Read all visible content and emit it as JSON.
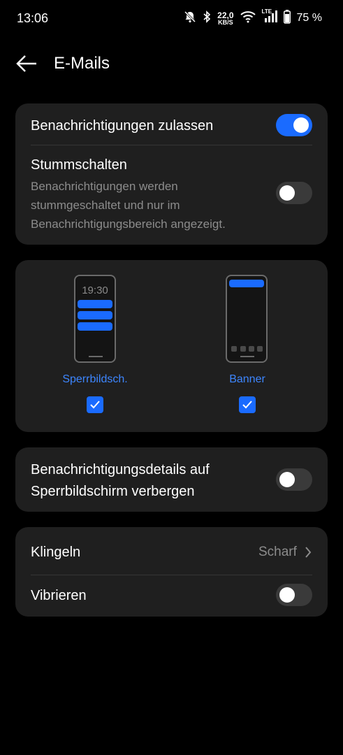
{
  "status_bar": {
    "time": "13:06",
    "net_speed_value": "22,0",
    "net_speed_unit": "KB/S",
    "network_type": "LTE",
    "battery_percent": "75 %",
    "icons": [
      "bell-muted-icon",
      "bluetooth-icon",
      "wifi-icon",
      "signal-icon",
      "battery-icon"
    ]
  },
  "header": {
    "title": "E-Mails",
    "back_icon": "arrow-left-icon"
  },
  "notifications_card": {
    "allow": {
      "label": "Benachrichtigungen zulassen",
      "enabled": true
    },
    "mute": {
      "label": "Stummschalten",
      "description": "Benachrichtigungen werden stummgeschaltet und nur im Benachrichtigungsbereich angezeigt.",
      "enabled": false
    }
  },
  "styles_card": {
    "lockscreen": {
      "preview_time": "19:30",
      "label": "Sperrbildsch.",
      "checked": true
    },
    "banner": {
      "label": "Banner",
      "checked": true
    }
  },
  "details_card": {
    "label": "Benachrichtigungsdetails auf Sperrbildschirm verbergen",
    "enabled": false
  },
  "sound_card": {
    "ring": {
      "label": "Klingeln",
      "value": "Scharf"
    },
    "vibrate": {
      "label": "Vibrieren",
      "enabled": false
    }
  },
  "colors": {
    "accent": "#1a6bff",
    "card": "#1f1f1f",
    "secondary_text": "#8c8c8c"
  }
}
